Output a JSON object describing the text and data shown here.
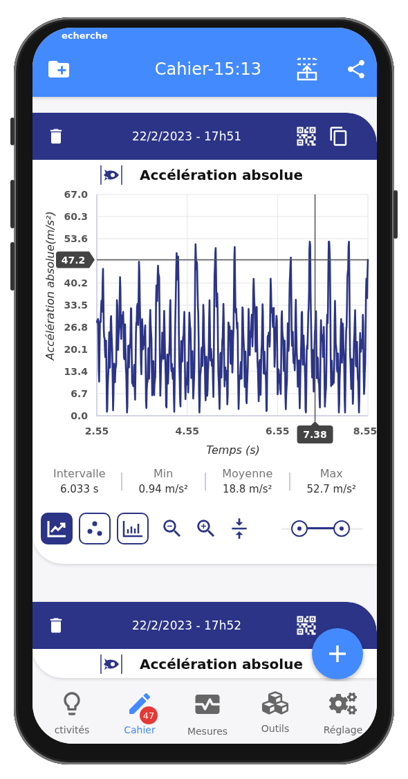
{
  "status_bar": {
    "text": "echerche"
  },
  "app_bar": {
    "title": "Cahier-15:13"
  },
  "cards": [
    {
      "date": "22/2/2023 - 17h51",
      "sensor": "Accélération absolue",
      "chart": {
        "ylabel": "Accélération absolue(m/s²)",
        "xlabel": "Temps (s)",
        "yticks_above_cursor": [
          "67.0",
          "60.3",
          "53.6"
        ],
        "yticks_below_cursor": [
          "40.2",
          "33.5",
          "26.8",
          "20.1",
          "13.4",
          "6.7",
          "0.0"
        ],
        "xticks": [
          "2.55",
          "4.55",
          "6.55",
          "8.55"
        ],
        "cursor": {
          "x_label": "7.38",
          "y_label": "47.2"
        }
      },
      "stats": [
        {
          "label": "Intervalle",
          "value": "6.033 s"
        },
        {
          "label": "Min",
          "value": "0.94 m/s²"
        },
        {
          "label": "Moyenne",
          "value": "18.8 m/s²"
        },
        {
          "label": "Max",
          "value": "52.7 m/s²"
        }
      ],
      "chart_types": [
        {
          "kind": "line",
          "selected": true
        },
        {
          "kind": "scatter",
          "selected": false
        },
        {
          "kind": "bar",
          "selected": false
        }
      ],
      "range_slider": {
        "thumbs": [
          {
            "level": 0.22
          },
          {
            "level": 0.74
          }
        ]
      }
    },
    {
      "date": "22/2/2023 - 17h52",
      "sensor": "Accélération absolue"
    }
  ],
  "nav": [
    {
      "label": "ctivités",
      "kind": "bulb",
      "selected": false
    },
    {
      "label": "Cahier",
      "kind": "pen",
      "selected": true,
      "badge": "47"
    },
    {
      "label": "Mesures",
      "kind": "monitor",
      "selected": false
    },
    {
      "label": "Outils",
      "kind": "cubes",
      "selected": false
    },
    {
      "label": "Réglage",
      "kind": "gears",
      "selected": false
    }
  ]
}
